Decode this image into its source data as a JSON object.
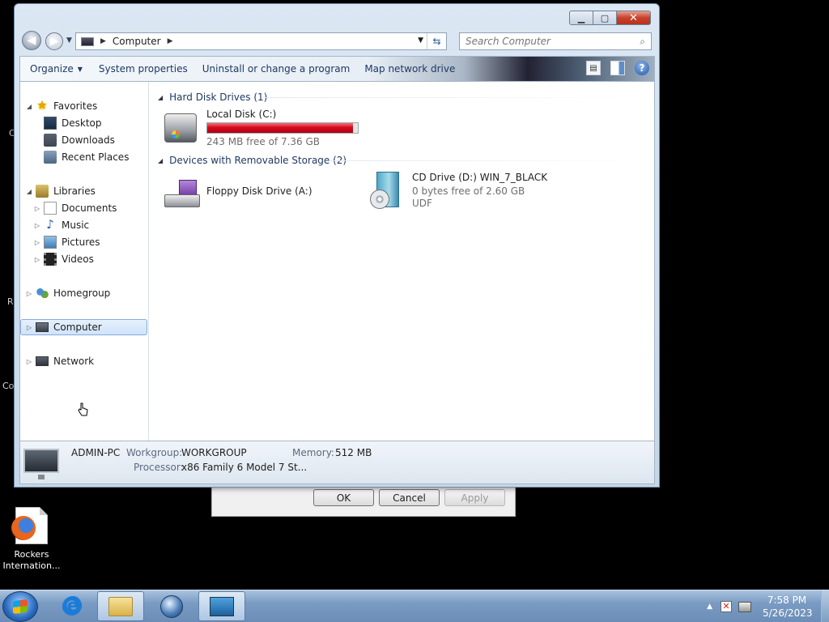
{
  "desktop": {
    "edge_fragments": [
      "C",
      "R",
      "Co"
    ],
    "icons": [
      {
        "label": "Rockers Internation...",
        "icon": "firefox-shortcut-icon"
      }
    ]
  },
  "background_dialog": {
    "ok_label": "OK",
    "cancel_label": "Cancel",
    "apply_label": "Apply"
  },
  "window": {
    "caption": {
      "min": "▁",
      "max": "▢",
      "close": "✕"
    },
    "address": {
      "path_sep": "▶",
      "location": "Computer",
      "after_sep": "▶"
    },
    "search": {
      "placeholder": "Search Computer"
    },
    "toolbar": {
      "organize": "Organize",
      "system_properties": "System properties",
      "uninstall": "Uninstall or change a program",
      "map_network": "Map network drive"
    },
    "nav": {
      "favorites": "Favorites",
      "desktop": "Desktop",
      "downloads": "Downloads",
      "recent_places": "Recent Places",
      "libraries": "Libraries",
      "documents": "Documents",
      "music": "Music",
      "pictures": "Pictures",
      "videos": "Videos",
      "homegroup": "Homegroup",
      "computer": "Computer",
      "network": "Network"
    },
    "groups": {
      "hdd_header": "Hard Disk Drives (1)",
      "removable_header": "Devices with Removable Storage (2)"
    },
    "drives": {
      "local_disk": {
        "name": "Local Disk (C:)",
        "free_text": "243 MB free of 7.36 GB",
        "used_fraction": 0.968
      },
      "floppy": {
        "name": "Floppy Disk Drive (A:)"
      },
      "cd": {
        "name": "CD Drive (D:) WIN_7_BLACK",
        "free_text": "0 bytes free of 2.60 GB",
        "fs": "UDF"
      }
    },
    "details": {
      "name": "ADMIN-PC",
      "workgroup_label": "Workgroup:",
      "workgroup": "WORKGROUP",
      "memory_label": "Memory:",
      "memory": "512 MB",
      "processor_label": "Processor:",
      "processor": "x86 Family 6 Model 7 St..."
    }
  },
  "taskbar": {
    "clock_time": "7:58 PM",
    "clock_date": "5/26/2023"
  },
  "colors": {
    "usage_bar": "#d8071a",
    "selection": "#cfe3fa",
    "taskbar": "#7a9bc2"
  }
}
